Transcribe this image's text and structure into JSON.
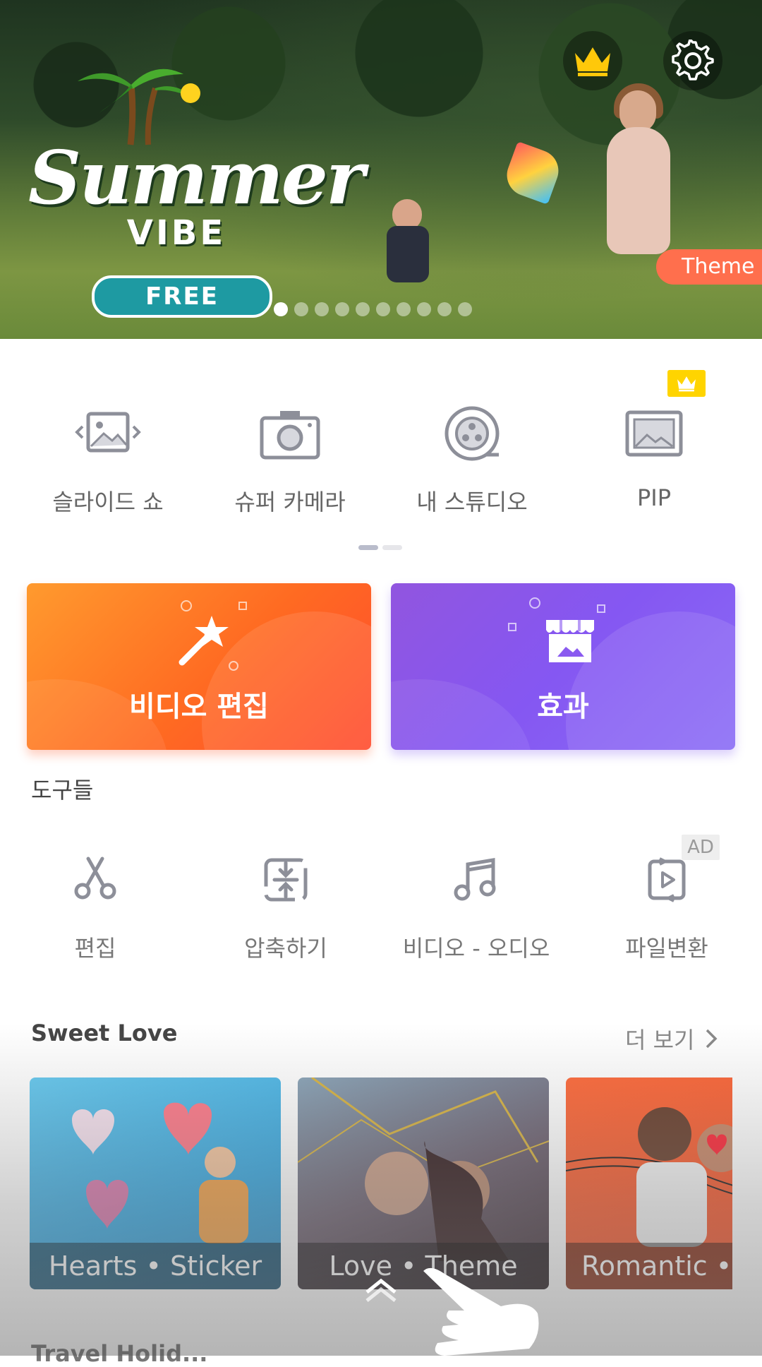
{
  "banner": {
    "title": "Summer",
    "subtitle": "VIBE",
    "badge": "FREE",
    "tag": "Theme",
    "dots_count": 10,
    "active_dot": 0
  },
  "features": [
    {
      "label": "슬라이드 쇼",
      "icon": "slideshow-icon"
    },
    {
      "label": "슈퍼 카메라",
      "icon": "camera-icon"
    },
    {
      "label": "내 스튜디오",
      "icon": "film-reel-icon"
    },
    {
      "label": "PIP",
      "icon": "pip-icon"
    }
  ],
  "cards": {
    "edit_label": "비디오 편집",
    "effect_label": "효과"
  },
  "tools_section": {
    "title": "도구들",
    "ad_label": "AD",
    "items": [
      {
        "label": "편집",
        "icon": "scissors-icon"
      },
      {
        "label": "압축하기",
        "icon": "compress-icon"
      },
      {
        "label": "비디오 - 오디오",
        "icon": "music-note-icon"
      },
      {
        "label": "파일변환",
        "icon": "convert-icon"
      }
    ]
  },
  "sweet_love": {
    "title": "Sweet Love",
    "more": "더 보기",
    "items": [
      {
        "caption": "Hearts • Sticker"
      },
      {
        "caption": "Love • Theme"
      },
      {
        "caption": "Romantic •"
      }
    ]
  },
  "next_section_title": "Travel Holid..."
}
